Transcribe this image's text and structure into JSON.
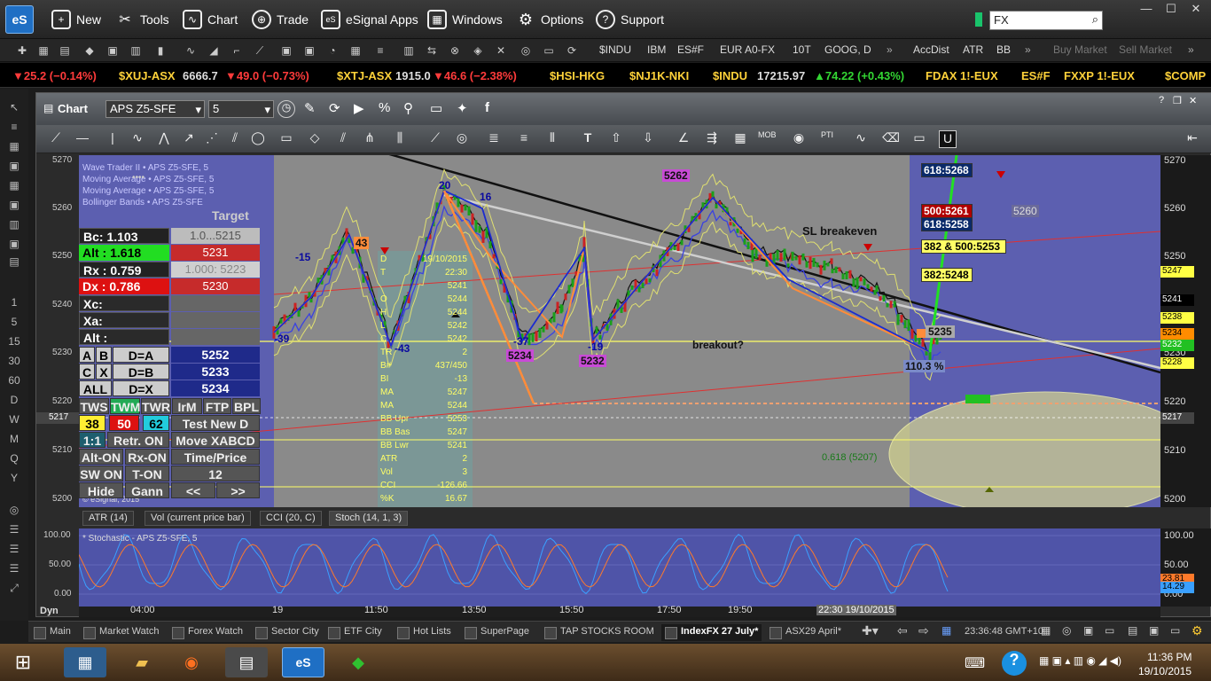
{
  "menu": {
    "logo": "eS",
    "items": [
      {
        "label": "New",
        "icon": "new-window-icon"
      },
      {
        "label": "Tools",
        "icon": "tools-icon"
      },
      {
        "label": "Chart",
        "icon": "chart-icon"
      },
      {
        "label": "Trade",
        "icon": "trade-globe-icon"
      },
      {
        "label": "eSignal Apps",
        "icon": "esignal-apps-icon"
      },
      {
        "label": "Windows",
        "icon": "windows-grid-icon"
      },
      {
        "label": "Options",
        "icon": "gear-icon"
      },
      {
        "label": "Support",
        "icon": "help-icon"
      }
    ],
    "search_value": "FX"
  },
  "toolbar": {
    "symbols": [
      "$INDU",
      "IBM",
      "ES#F",
      "EUR A0-FX",
      "10T",
      "GOOG, D"
    ],
    "studies": [
      "AccDist",
      "ATR",
      "BB"
    ],
    "buy": "Buy Market",
    "sell": "Sell Market"
  },
  "ticker": [
    {
      "sym": "",
      "val": "",
      "chg": "▼25.2 (−0.14%)",
      "dir": "down"
    },
    {
      "sym": "$XUJ-ASX",
      "val": "6666.7",
      "chg": "▼49.0 (−0.73%)",
      "dir": "down"
    },
    {
      "sym": "$XTJ-ASX",
      "val": "1915.0",
      "chg": "▼46.6 (−2.38%)",
      "dir": "down"
    },
    {
      "sym": "$HSI-HKG",
      "val": "",
      "chg": "",
      "dir": ""
    },
    {
      "sym": "$NJ1K-NKI",
      "val": "",
      "chg": "",
      "dir": ""
    },
    {
      "sym": "$INDU",
      "val": "17215.97",
      "chg": "▲74.22 (+0.43%)",
      "dir": "up"
    },
    {
      "sym": "FDAX 1!-EUX",
      "val": "",
      "chg": "",
      "dir": ""
    },
    {
      "sym": "ES#F",
      "val": "",
      "chg": "",
      "dir": ""
    },
    {
      "sym": "FXXP 1!-EUX",
      "val": "",
      "chg": "",
      "dir": ""
    },
    {
      "sym": "$COMP",
      "val": "",
      "chg": "",
      "dir": ""
    }
  ],
  "left_strip": [
    "1",
    "5",
    "15",
    "30",
    "60",
    "D",
    "W",
    "M",
    "Q",
    "Y"
  ],
  "chart": {
    "title": "Chart",
    "symbol": "APS Z5-SFE",
    "interval": "5",
    "yticks": [
      "5270",
      "5260",
      "5250",
      "5240",
      "5230",
      "5220",
      "5210",
      "5200"
    ],
    "price_tags": [
      {
        "label": "5247",
        "color": "#ffff00"
      },
      {
        "label": "5241",
        "color": "#000000"
      },
      {
        "label": "5238",
        "color": "#ffff00"
      },
      {
        "label": "5234",
        "color": "#ff8c00"
      },
      {
        "label": "5232",
        "color": "#22c022"
      },
      {
        "label": "5228",
        "color": "#ffff00"
      },
      {
        "label": "5217",
        "color": "#444444"
      }
    ],
    "left_price": "5217",
    "annotations": {
      "sl_breakeven": "SL breakeven",
      "breakout": "breakout?",
      "fib_618": "0.618 (5207)",
      "pct": "110.3 %",
      "price_5235": "5235",
      "price_5260": "5260",
      "pivot_5262": "5262",
      "pivot_5232": "5232",
      "pivot_5234": "5234",
      "pivot_20": "20",
      "pivot_16": "16",
      "pivot_15": "-15",
      "pivot_39": "-39",
      "pivot_43": "43",
      "pivot_n43": "-43",
      "pivot_37": "-37",
      "pivot_19": "-19"
    },
    "targets": [
      {
        "label": "618:5268",
        "bg": "#0a2a6a",
        "fg": "#ffffff"
      },
      {
        "label": "500:5261",
        "bg": "#b00000",
        "fg": "#ffffff"
      },
      {
        "label": "618:5258",
        "bg": "#0a2a6a",
        "fg": "#ffffff"
      },
      {
        "label": "382 & 500:5253",
        "bg": "#ffff66",
        "fg": "#000000"
      },
      {
        "label": "382:5248",
        "bg": "#ffff66",
        "fg": "#000000"
      }
    ],
    "legend_lines": [
      "Wave Trader II • APS Z5-SFE, 5",
      "Moving Average • APS Z5-SFE, 5",
      "Moving Average • APS Z5-SFE, 5",
      "Bollinger Bands • APS Z5-SFE",
      "© eSignal, 2015"
    ]
  },
  "panel": {
    "bc_label": "Bc: ",
    "bc_value": "1.103",
    "bc_field": "1.0...5215",
    "alt_label": "Alt : ",
    "alt_value": "1.618",
    "alt_field": "5231",
    "rx_label": "Rx : ",
    "rx_value": "0.759",
    "rx_field": "1.000: 5223",
    "dx_label": "Dx : ",
    "dx_value": "0.786",
    "dx_field": "5230",
    "xc": "Xc:",
    "xa": "Xa:",
    "alt2": "Alt :",
    "rows": [
      {
        "a": "A",
        "b": "B",
        "d": "D=A",
        "v": "5252"
      },
      {
        "a": "C",
        "b": "X",
        "d": "D=B",
        "v": "5233"
      },
      {
        "a": "ALL",
        "b": "",
        "d": "D=X",
        "v": "5234"
      }
    ],
    "tabs": [
      "TWS",
      "TWM",
      "TWR",
      "IrM",
      "FTP",
      "BPL"
    ],
    "nums": [
      "38",
      "50",
      "62"
    ],
    "test_new": "Test New D",
    "ratio": "1:1",
    "retr": "Retr. ON",
    "move": "Move XABCD",
    "alt_on": "Alt-ON",
    "rx_on": "Rx-ON",
    "time_price": "Time/Price",
    "sw_on": "SW ON",
    "t_on": "T-ON",
    "twelve": "12",
    "hide": "Hide",
    "gann": "Gann",
    "prev": "<<",
    "next": ">>",
    "target_hint": "Target",
    "dots": "••••"
  },
  "datawindow": {
    "rows": [
      [
        "D",
        "19/10/2015"
      ],
      [
        "T",
        "22:30"
      ],
      [
        "",
        "5241"
      ],
      [
        "O",
        "5244"
      ],
      [
        "H",
        "5244"
      ],
      [
        "L",
        "5242"
      ],
      [
        "C",
        "5242"
      ],
      [
        "TR",
        "2"
      ],
      [
        "B#",
        "437/450"
      ],
      [
        "BI",
        "-13"
      ],
      [
        "MA",
        "5247"
      ],
      [
        "MA",
        "5244"
      ],
      [
        "BB Upr",
        "5253"
      ],
      [
        "BB Bas",
        "5247"
      ],
      [
        "BB Lwr",
        "5241"
      ],
      [
        "ATR",
        "2"
      ],
      [
        "Vol",
        "3"
      ],
      [
        "CCI",
        "-126.66"
      ],
      [
        "%K",
        "16.67"
      ],
      [
        "%D",
        "22.22"
      ]
    ]
  },
  "lower": {
    "tabs": [
      "ATR (14)",
      "Vol (current price bar)",
      "CCI (20, C)",
      "Stoch (14, 1, 3)"
    ],
    "stoch_title": "* Stochastic - APS Z5-SFE, 5",
    "yticks": [
      "100.00",
      "50.00",
      "0.00"
    ],
    "k": "23.81",
    "d": "14.29"
  },
  "xaxis": {
    "dyn": "Dyn",
    "labels": [
      "04:00",
      "19",
      "11:50",
      "13:50",
      "15:50",
      "17:50",
      "19:50"
    ],
    "cursor": "22:30 19/10/2015"
  },
  "pages": {
    "tabs": [
      "Main",
      "Market Watch",
      "Forex Watch",
      "Sector City",
      "ETF City",
      "Hot Lists",
      "SuperPage",
      "TAP STOCKS ROOM",
      "IndexFX 27 July*",
      "ASX29 April*"
    ],
    "clock": "23:36:48 GMT+10"
  },
  "tray": {
    "time": "11:36 PM",
    "date": "19/10/2015"
  }
}
